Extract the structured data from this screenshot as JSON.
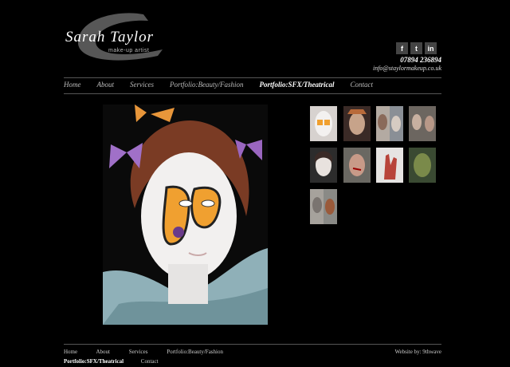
{
  "brand": {
    "name": "Sarah Taylor",
    "tagline": "make-up artist"
  },
  "social": [
    {
      "label": "f",
      "icon": "facebook-icon"
    },
    {
      "label": "t",
      "icon": "twitter-icon"
    },
    {
      "label": "in",
      "icon": "linkedin-icon"
    }
  ],
  "contact": {
    "phone": "07894 236894",
    "email": "info@staylormakeup.co.uk"
  },
  "nav": {
    "items": [
      {
        "label": "Home"
      },
      {
        "label": "About"
      },
      {
        "label": "Services"
      },
      {
        "label": "Portfolio:Beauty/Fashion"
      },
      {
        "label": "Portfolio:SFX/Theatrical",
        "active": true
      },
      {
        "label": "Contact"
      }
    ]
  },
  "footer": {
    "links": [
      "Home",
      "About",
      "Services",
      "Portfolio:Beauty/Fashion",
      "Portfolio:SFX/Theatrical",
      "Contact"
    ],
    "credit": "Website by: 9thwave"
  },
  "colors": {
    "background": "#000000",
    "rule": "#555555",
    "social_bg": "#444444"
  }
}
